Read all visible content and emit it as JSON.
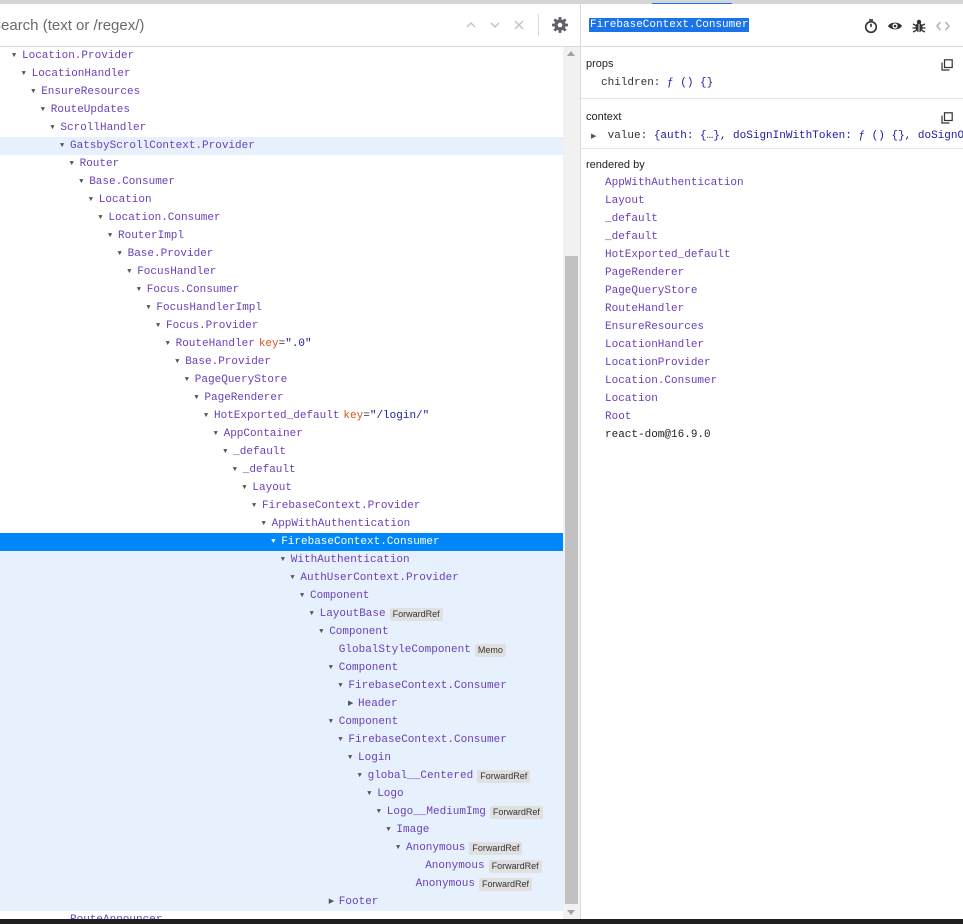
{
  "search": {
    "placeholder": "Search (text or /regex/)"
  },
  "tree": {
    "rows": [
      {
        "name": "Location.Provider",
        "depth": 1,
        "toggle": "down"
      },
      {
        "name": "LocationHandler",
        "depth": 2,
        "toggle": "down"
      },
      {
        "name": "EnsureResources",
        "depth": 3,
        "toggle": "down"
      },
      {
        "name": "RouteUpdates",
        "depth": 4,
        "toggle": "down"
      },
      {
        "name": "ScrollHandler",
        "depth": 5,
        "toggle": "down"
      },
      {
        "name": "GatsbyScrollContext.Provider",
        "depth": 6,
        "toggle": "down",
        "state": "hl"
      },
      {
        "name": "Router",
        "depth": 7,
        "toggle": "down"
      },
      {
        "name": "Base.Consumer",
        "depth": 8,
        "toggle": "down"
      },
      {
        "name": "Location",
        "depth": 9,
        "toggle": "down"
      },
      {
        "name": "Location.Consumer",
        "depth": 10,
        "toggle": "down"
      },
      {
        "name": "RouterImpl",
        "depth": 11,
        "toggle": "down"
      },
      {
        "name": "Base.Provider",
        "depth": 12,
        "toggle": "down"
      },
      {
        "name": "FocusHandler",
        "depth": 13,
        "toggle": "down"
      },
      {
        "name": "Focus.Consumer",
        "depth": 14,
        "toggle": "down"
      },
      {
        "name": "FocusHandlerImpl",
        "depth": 15,
        "toggle": "down"
      },
      {
        "name": "Focus.Provider",
        "depth": 16,
        "toggle": "down"
      },
      {
        "name": "RouteHandler",
        "depth": 17,
        "toggle": "down",
        "key": "\".0\""
      },
      {
        "name": "Base.Provider",
        "depth": 18,
        "toggle": "down"
      },
      {
        "name": "PageQueryStore",
        "depth": 19,
        "toggle": "down"
      },
      {
        "name": "PageRenderer",
        "depth": 20,
        "toggle": "down"
      },
      {
        "name": "HotExported_default",
        "depth": 21,
        "toggle": "down",
        "key": "\"/login/\""
      },
      {
        "name": "AppContainer",
        "depth": 22,
        "toggle": "down"
      },
      {
        "name": "_default",
        "depth": 23,
        "toggle": "down"
      },
      {
        "name": "_default",
        "depth": 24,
        "toggle": "down"
      },
      {
        "name": "Layout",
        "depth": 25,
        "toggle": "down"
      },
      {
        "name": "FirebaseContext.Provider",
        "depth": 26,
        "toggle": "down"
      },
      {
        "name": "AppWithAuthentication",
        "depth": 27,
        "toggle": "down"
      },
      {
        "name": "FirebaseContext.Consumer",
        "depth": 28,
        "toggle": "down",
        "state": "sel"
      },
      {
        "name": "WithAuthentication",
        "depth": 29,
        "toggle": "down",
        "state": "hl"
      },
      {
        "name": "AuthUserContext.Provider",
        "depth": 30,
        "toggle": "down",
        "state": "hl"
      },
      {
        "name": "Component",
        "depth": 31,
        "toggle": "down",
        "state": "hl"
      },
      {
        "name": "LayoutBase",
        "depth": 32,
        "toggle": "down",
        "badge": "ForwardRef",
        "state": "hl"
      },
      {
        "name": "Component",
        "depth": 33,
        "toggle": "down",
        "state": "hl"
      },
      {
        "name": "GlobalStyleComponent",
        "depth": 34,
        "toggle": "none",
        "badge": "Memo",
        "state": "hl"
      },
      {
        "name": "Component",
        "depth": 34,
        "toggle": "down",
        "state": "hl"
      },
      {
        "name": "FirebaseContext.Consumer",
        "depth": 35,
        "toggle": "down",
        "state": "hl"
      },
      {
        "name": "Header",
        "depth": 36,
        "toggle": "right",
        "state": "hl"
      },
      {
        "name": "Component",
        "depth": 34,
        "toggle": "down",
        "state": "hl"
      },
      {
        "name": "FirebaseContext.Consumer",
        "depth": 35,
        "toggle": "down",
        "state": "hl"
      },
      {
        "name": "Login",
        "depth": 36,
        "toggle": "down",
        "state": "hl"
      },
      {
        "name": "global__Centered",
        "depth": 37,
        "toggle": "down",
        "badge": "ForwardRef",
        "state": "hl"
      },
      {
        "name": "Logo",
        "depth": 38,
        "toggle": "down",
        "state": "hl"
      },
      {
        "name": "Logo__MediumImg",
        "depth": 39,
        "toggle": "down",
        "badge": "ForwardRef",
        "state": "hl"
      },
      {
        "name": "Image",
        "depth": 40,
        "toggle": "down",
        "state": "hl"
      },
      {
        "name": "Anonymous",
        "depth": 41,
        "toggle": "down",
        "badge": "ForwardRef",
        "state": "hl"
      },
      {
        "name": "Anonymous",
        "depth": 43,
        "toggle": "none",
        "badge": "ForwardRef",
        "state": "hl"
      },
      {
        "name": "Anonymous",
        "depth": 42,
        "toggle": "none",
        "badge": "ForwardRef",
        "state": "hl"
      },
      {
        "name": "Footer",
        "depth": 34,
        "toggle": "right",
        "state": "hl"
      },
      {
        "name": "RouteAnnouncer",
        "depth": 6,
        "toggle": "none"
      }
    ]
  },
  "inspector": {
    "component_name": "FirebaseContext.Consumer",
    "props": {
      "title": "props",
      "key": "children:",
      "value": "ƒ () {}"
    },
    "context": {
      "title": "context",
      "key": "value:",
      "value": "{auth: {…}, doSignInWithToken: ƒ () {}, doSignOut:…"
    },
    "rendered_by": {
      "title": "rendered by",
      "items": [
        "AppWithAuthentication",
        "Layout",
        "_default",
        "_default",
        "HotExported_default",
        "PageRenderer",
        "PageQueryStore",
        "RouteHandler",
        "EnsureResources",
        "LocationHandler",
        "LocationProvider",
        "Location.Consumer",
        "Location",
        "Root",
        "react-dom@16.9.0"
      ]
    }
  },
  "colors": {
    "selected_row": "#0088fa",
    "highlight_row": "#e6f1fd",
    "component_name": "#6a3fb8",
    "key_name": "#d4561d"
  }
}
